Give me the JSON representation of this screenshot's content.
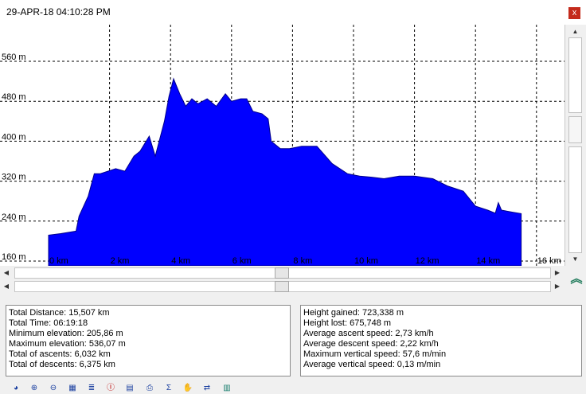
{
  "window": {
    "title": "29-APR-18 04:10:28 PM",
    "close_label": "x"
  },
  "chart_data": {
    "type": "area",
    "title": "",
    "xlabel": "",
    "ylabel": "",
    "xlim": [
      0,
      16.2
    ],
    "ylim": [
      150,
      600
    ],
    "x_ticks": [
      0,
      2,
      4,
      6,
      8,
      10,
      12,
      14,
      16
    ],
    "x_tick_labels": [
      "0 km",
      "2 km",
      "4 km",
      "6 km",
      "8 km",
      "10 km",
      "12 km",
      "14 km",
      "16 km"
    ],
    "y_ticks": [
      160,
      240,
      320,
      400,
      480,
      560
    ],
    "y_tick_labels": [
      "160 m",
      "240 m",
      "320 m",
      "400 m",
      "480 m",
      "560 m"
    ],
    "grid": true,
    "fill_color": "#0000ff",
    "series": [
      {
        "x": [
          0,
          0.4,
          0.9,
          1.0,
          1.3,
          1.5,
          1.7,
          2.2,
          2.5,
          2.8,
          3.0,
          3.3,
          3.5,
          3.8,
          3.95,
          4.1,
          4.3,
          4.5,
          4.7,
          4.9,
          5.2,
          5.5,
          5.8,
          6.0,
          6.3,
          6.5,
          6.7,
          7.0,
          7.2,
          7.3,
          7.6,
          7.9,
          8.3,
          8.8,
          9.3,
          9.8,
          10.2,
          10.6,
          11.0,
          11.5,
          12.0,
          12.6,
          13.1,
          13.6,
          14.0,
          14.4,
          14.65,
          14.75,
          14.85,
          15.2,
          15.5
        ],
        "y": [
          212,
          215,
          220,
          250,
          290,
          335,
          335,
          345,
          340,
          370,
          380,
          410,
          370,
          440,
          490,
          525,
          495,
          470,
          485,
          475,
          485,
          470,
          495,
          480,
          485,
          485,
          460,
          455,
          445,
          400,
          385,
          385,
          390,
          390,
          355,
          335,
          330,
          328,
          325,
          330,
          330,
          325,
          310,
          300,
          270,
          262,
          256,
          277,
          262,
          258,
          255
        ]
      }
    ]
  },
  "stats_left": [
    "Total Distance: 15,507 km",
    "Total Time: 06:19:18",
    "Minimum elevation: 205,86 m",
    "Maximum elevation: 536,07 m",
    "Total of ascents: 6,032 km",
    "Total of descents: 6,375 km"
  ],
  "stats_right": [
    "Height gained: 723,338 m",
    "Height lost: 675,748 m",
    "Average ascent speed: 2,73 km/h",
    "Average descent speed: 2,22 km/h",
    "Maximum vertical speed: 57,6 m/min",
    "Average vertical speed: 0,13 m/min"
  ],
  "toolbar": [
    "globe-icon",
    "zoom-in-icon",
    "zoom-out-icon",
    "grid-icon",
    "settings-list-icon",
    "find-icon",
    "document-icon",
    "print-icon",
    "sigma-icon",
    "hand-icon",
    "swap-icon",
    "export-icon"
  ],
  "icons": {
    "toolbar_glyphs": [
      "◕",
      "⊕",
      "⊖",
      "▦",
      "≣",
      "Ⓘ",
      "▤",
      "⎙",
      "Σ",
      "✋",
      "⇄",
      "▥"
    ]
  }
}
